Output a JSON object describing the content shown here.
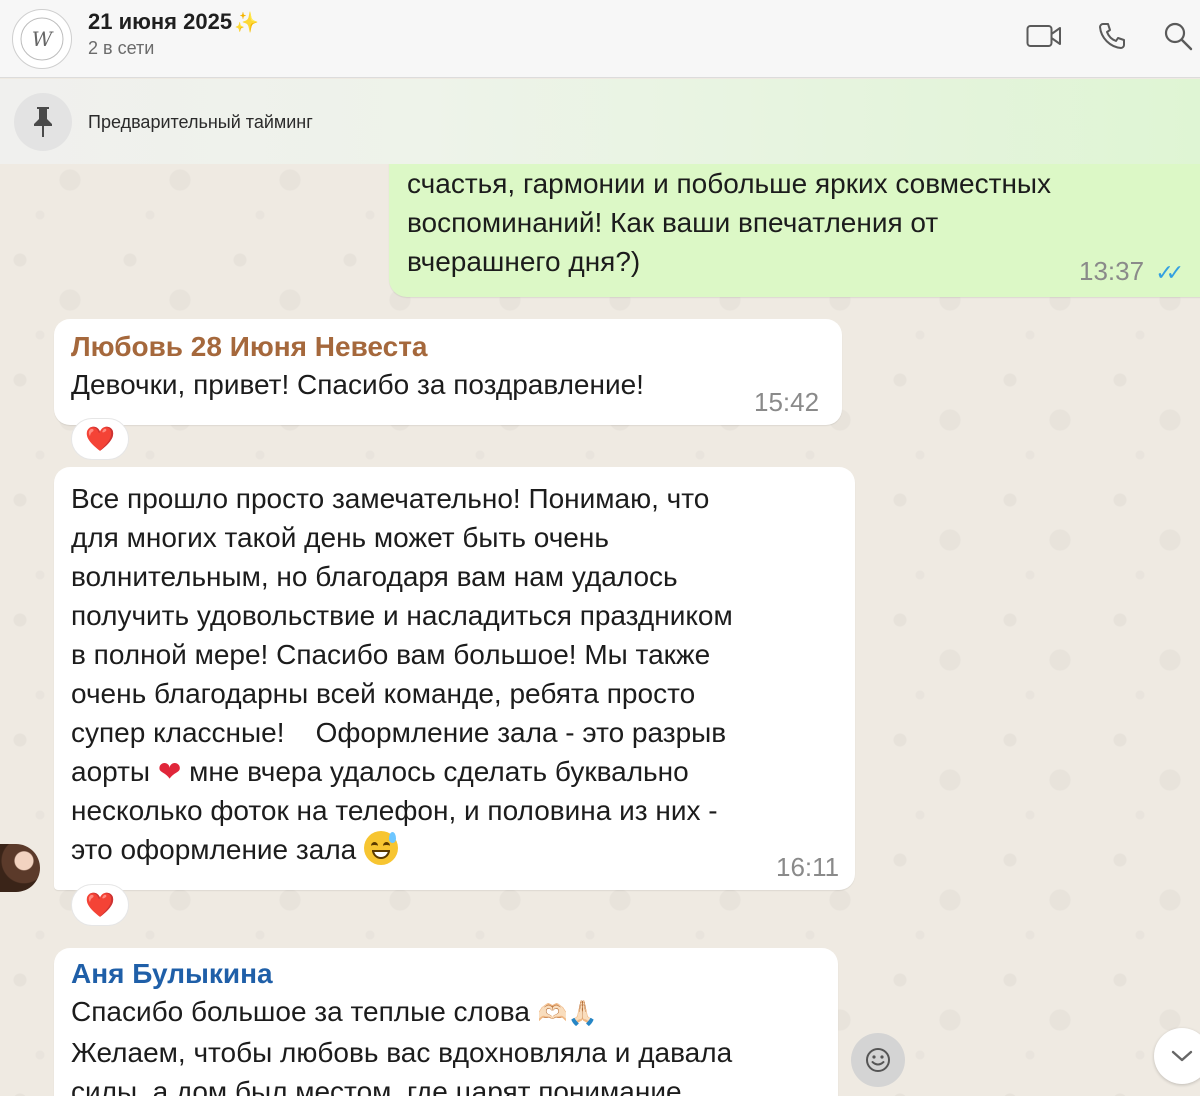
{
  "header": {
    "title": "21 июня 2025",
    "title_emoji": "✨",
    "subtitle": "2 в сети",
    "icons": [
      "video-call-icon",
      "phone-icon",
      "search-icon"
    ]
  },
  "pinned": {
    "text": "Предварительный тайминг"
  },
  "messages": [
    {
      "direction": "outgoing",
      "lines": [
        "счастья, гармонии и побольше ярких совместных",
        "воспоминаний! Как ваши впечатления от",
        "вчерашнего дня?)"
      ],
      "time": "13:37",
      "status": "read"
    },
    {
      "direction": "incoming",
      "sender": "Любовь 28 Июня Невеста",
      "sender_color": "#a5683c",
      "text": "Девочки, привет! Спасибо за поздравление!",
      "time": "15:42",
      "reaction": "❤️"
    },
    {
      "direction": "incoming",
      "lines": [
        "Все прошло просто замечательно! Понимаю, что",
        "для многих такой день может быть очень",
        "волнительным, но благодаря вам нам удалось",
        "получить удовольствие и насладиться праздником",
        "в полной мере! Спасибо вам большое! Мы также",
        "очень благодарны всей команде, ребята просто",
        "супер классные!    Оформление зала - это разрыв"
      ],
      "line8_a": "аорты",
      "line8_b": "мне вчера удалось сделать буквально",
      "line9": "несколько фоток на телефон, и половина из них -",
      "line10": "это оформление зала",
      "time": "16:11",
      "reaction": "❤️"
    },
    {
      "direction": "incoming",
      "sender": "Аня Булыкина",
      "sender_color": "#1f5fa8",
      "line1": "Спасибо большое за теплые слова",
      "line1_emojis": "🫶🏻🙏🏻",
      "line2": "Желаем, чтобы любовь вас вдохновляла и давала",
      "line3": "силы, а дом был местом, где царят понимание"
    }
  ],
  "colors": {
    "outgoing_bubble": "#dcf8c6",
    "incoming_bubble": "#ffffff",
    "read_ticks": "#34a0e0",
    "background": "#efeae2"
  }
}
